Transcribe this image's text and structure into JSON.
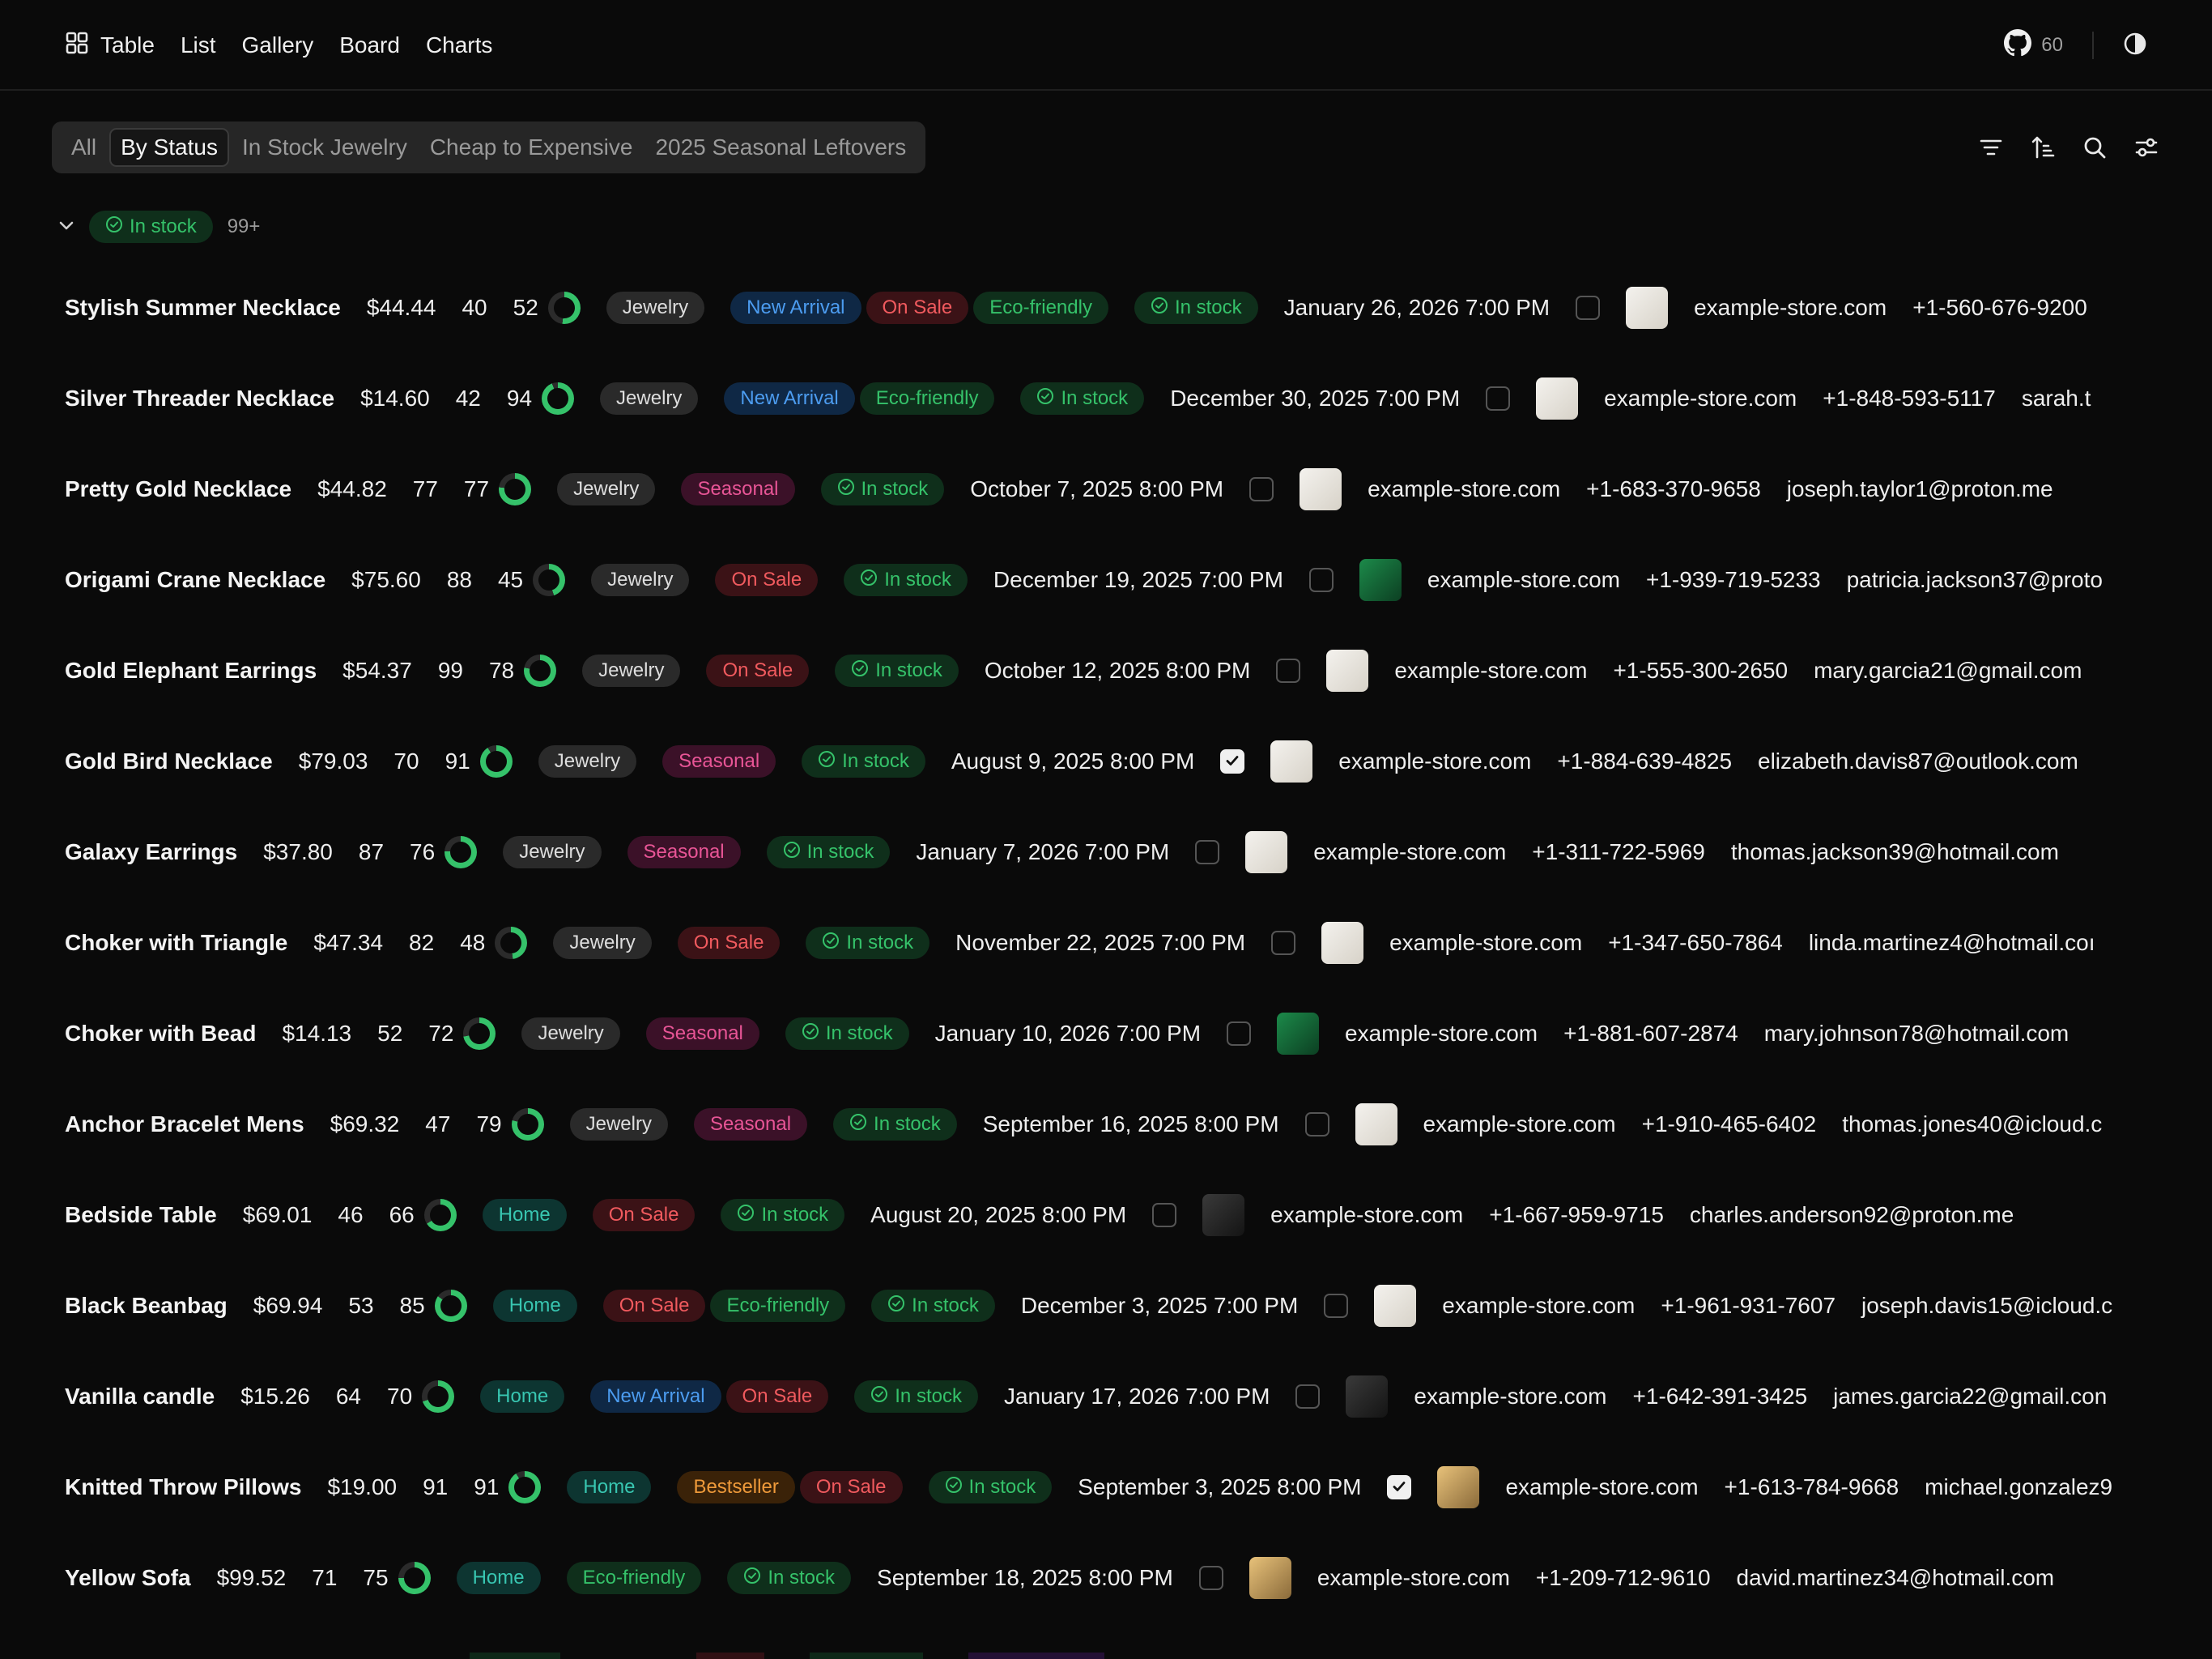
{
  "nav": {
    "items": [
      "Table",
      "List",
      "Gallery",
      "Board",
      "Charts"
    ],
    "github_stars": "60"
  },
  "views": {
    "tabs": [
      "All",
      "By Status",
      "In Stock Jewelry",
      "Cheap to Expensive",
      "2025 Seasonal Leftovers"
    ],
    "active": "By Status"
  },
  "toolbar": {
    "icons": [
      "filter-icon",
      "sort-icon",
      "search-icon",
      "settings-sliders-icon"
    ]
  },
  "group": {
    "label": "In stock",
    "count": "99+"
  },
  "status_label": "In stock",
  "colors": {
    "background": "#0a0a0a",
    "stock_green": "#35c26a",
    "sale_red": "#f05a5e",
    "new_blue": "#4c9cf0",
    "seasonal_pink": "#e85596",
    "home_teal": "#38c6b1",
    "bestseller_orange": "#ef9a3a"
  },
  "rows": [
    {
      "name": "Stylish Summer Necklace",
      "price": "$44.44",
      "qty1": "40",
      "qty2": "52",
      "progress": 0.52,
      "category": "Jewelry",
      "tags": [
        "New Arrival",
        "On Sale",
        "Eco-friendly"
      ],
      "date": "January 26, 2026 7:00 PM",
      "checked": false,
      "thumb": "light",
      "site": "example-store.com",
      "phone": "+1-560-676-9200",
      "email": ""
    },
    {
      "name": "Silver Threader Necklace",
      "price": "$14.60",
      "qty1": "42",
      "qty2": "94",
      "progress": 0.94,
      "category": "Jewelry",
      "tags": [
        "New Arrival",
        "Eco-friendly"
      ],
      "date": "December 30, 2025 7:00 PM",
      "checked": false,
      "thumb": "light",
      "site": "example-store.com",
      "phone": "+1-848-593-5117",
      "email": "sarah.t"
    },
    {
      "name": "Pretty Gold Necklace",
      "price": "$44.82",
      "qty1": "77",
      "qty2": "77",
      "progress": 0.77,
      "category": "Jewelry",
      "tags": [
        "Seasonal"
      ],
      "date": "October 7, 2025 8:00 PM",
      "checked": false,
      "thumb": "light",
      "site": "example-store.com",
      "phone": "+1-683-370-9658",
      "email": "joseph.taylor1@proton.me"
    },
    {
      "name": "Origami Crane Necklace",
      "price": "$75.60",
      "qty1": "88",
      "qty2": "45",
      "progress": 0.45,
      "category": "Jewelry",
      "tags": [
        "On Sale"
      ],
      "date": "December 19, 2025 7:00 PM",
      "checked": false,
      "thumb": "green",
      "site": "example-store.com",
      "phone": "+1-939-719-5233",
      "email": "patricia.jackson37@proto"
    },
    {
      "name": "Gold Elephant Earrings",
      "price": "$54.37",
      "qty1": "99",
      "qty2": "78",
      "progress": 0.78,
      "category": "Jewelry",
      "tags": [
        "On Sale"
      ],
      "date": "October 12, 2025 8:00 PM",
      "checked": false,
      "thumb": "light",
      "site": "example-store.com",
      "phone": "+1-555-300-2650",
      "email": "mary.garcia21@gmail.com"
    },
    {
      "name": "Gold Bird Necklace",
      "price": "$79.03",
      "qty1": "70",
      "qty2": "91",
      "progress": 0.91,
      "category": "Jewelry",
      "tags": [
        "Seasonal"
      ],
      "date": "August 9, 2025 8:00 PM",
      "checked": true,
      "thumb": "light",
      "site": "example-store.com",
      "phone": "+1-884-639-4825",
      "email": "elizabeth.davis87@outlook.com"
    },
    {
      "name": "Galaxy Earrings",
      "price": "$37.80",
      "qty1": "87",
      "qty2": "76",
      "progress": 0.76,
      "category": "Jewelry",
      "tags": [
        "Seasonal"
      ],
      "date": "January 7, 2026 7:00 PM",
      "checked": false,
      "thumb": "light",
      "site": "example-store.com",
      "phone": "+1-311-722-5969",
      "email": "thomas.jackson39@hotmail.com"
    },
    {
      "name": "Choker with Triangle",
      "price": "$47.34",
      "qty1": "82",
      "qty2": "48",
      "progress": 0.48,
      "category": "Jewelry",
      "tags": [
        "On Sale"
      ],
      "date": "November 22, 2025 7:00 PM",
      "checked": false,
      "thumb": "light",
      "site": "example-store.com",
      "phone": "+1-347-650-7864",
      "email": "linda.martinez4@hotmail.coı"
    },
    {
      "name": "Choker with Bead",
      "price": "$14.13",
      "qty1": "52",
      "qty2": "72",
      "progress": 0.72,
      "category": "Jewelry",
      "tags": [
        "Seasonal"
      ],
      "date": "January 10, 2026 7:00 PM",
      "checked": false,
      "thumb": "green",
      "site": "example-store.com",
      "phone": "+1-881-607-2874",
      "email": "mary.johnson78@hotmail.com"
    },
    {
      "name": "Anchor Bracelet Mens",
      "price": "$69.32",
      "qty1": "47",
      "qty2": "79",
      "progress": 0.79,
      "category": "Jewelry",
      "tags": [
        "Seasonal"
      ],
      "date": "September 16, 2025 8:00 PM",
      "checked": false,
      "thumb": "light",
      "site": "example-store.com",
      "phone": "+1-910-465-6402",
      "email": "thomas.jones40@icloud.c"
    },
    {
      "name": "Bedside Table",
      "price": "$69.01",
      "qty1": "46",
      "qty2": "66",
      "progress": 0.66,
      "category": "Home",
      "tags": [
        "On Sale"
      ],
      "date": "August 20, 2025 8:00 PM",
      "checked": false,
      "thumb": "dark",
      "site": "example-store.com",
      "phone": "+1-667-959-9715",
      "email": "charles.anderson92@proton.me"
    },
    {
      "name": "Black Beanbag",
      "price": "$69.94",
      "qty1": "53",
      "qty2": "85",
      "progress": 0.85,
      "category": "Home",
      "tags": [
        "On Sale",
        "Eco-friendly"
      ],
      "date": "December 3, 2025 7:00 PM",
      "checked": false,
      "thumb": "light",
      "site": "example-store.com",
      "phone": "+1-961-931-7607",
      "email": "joseph.davis15@icloud.c"
    },
    {
      "name": "Vanilla candle",
      "price": "$15.26",
      "qty1": "64",
      "qty2": "70",
      "progress": 0.7,
      "category": "Home",
      "tags": [
        "New Arrival",
        "On Sale"
      ],
      "date": "January 17, 2026 7:00 PM",
      "checked": false,
      "thumb": "dark",
      "site": "example-store.com",
      "phone": "+1-642-391-3425",
      "email": "james.garcia22@gmail.con"
    },
    {
      "name": "Knitted Throw Pillows",
      "price": "$19.00",
      "qty1": "91",
      "qty2": "91",
      "progress": 0.91,
      "category": "Home",
      "tags": [
        "Bestseller",
        "On Sale"
      ],
      "date": "September 3, 2025 8:00 PM",
      "checked": true,
      "thumb": "warm",
      "site": "example-store.com",
      "phone": "+1-613-784-9668",
      "email": "michael.gonzalez9"
    },
    {
      "name": "Yellow Sofa",
      "price": "$99.52",
      "qty1": "71",
      "qty2": "75",
      "progress": 0.75,
      "category": "Home",
      "tags": [
        "Eco-friendly"
      ],
      "date": "September 18, 2025 8:00 PM",
      "checked": false,
      "thumb": "warm",
      "site": "example-store.com",
      "phone": "+1-209-712-9610",
      "email": "david.martinez34@hotmail.com"
    }
  ]
}
